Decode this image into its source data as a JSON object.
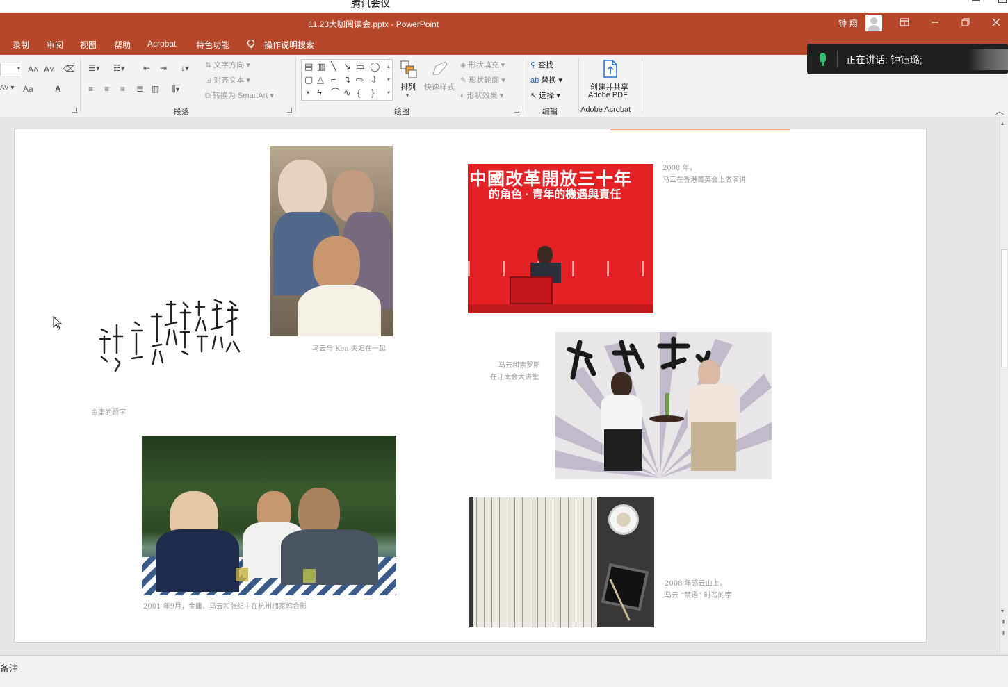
{
  "meeting": {
    "app_title": "腾讯会议"
  },
  "window": {
    "title": "11.23大咖阅读会.pptx  -  PowerPoint",
    "user": "钟 翔"
  },
  "menu": {
    "tabs": [
      "录制",
      "审阅",
      "视图",
      "帮助",
      "Acrobat",
      "特色功能"
    ],
    "search": "操作说明搜索"
  },
  "ribbon": {
    "font_size_up": "A˄",
    "font_size_down": "A˅",
    "change_case": "Aa",
    "font_color": "A",
    "text_direction": "文字方向",
    "align_text": "对齐文本",
    "smartart": "转换为 SmartArt",
    "paragraph_group": "段落",
    "arrange": "排列",
    "quick_styles": "快速样式",
    "shape_fill": "形状填充",
    "shape_outline": "形状轮廓",
    "shape_effects": "形状效果",
    "drawing_group": "绘图",
    "find": "查找",
    "replace": "替换",
    "select": "选择",
    "editing_group": "编辑",
    "create_share_1": "创建并共享",
    "create_share_2": "Adobe PDF",
    "acrobat_group": "Adobe Acrobat"
  },
  "speaking": {
    "text": "正在讲话: 钟钰璐;"
  },
  "slide": {
    "photo_left_top_caption": "马云与 Ken 夫妇在一起",
    "calligraphy_caption": "金庸的题字",
    "photo_left_bottom_caption": "2001 年9月，金庸、马云和张纪中在杭州梅家坞合影",
    "red_banner_title": "中國改革開放三十年",
    "red_banner_subtitle": "的角色 · 青年的機遇與責任",
    "red_photo_caption_1": "2008 年，",
    "red_photo_caption_2": "马云在香港菁英会上做演讲",
    "stage_caption_1": "马云和索罗斯",
    "stage_caption_2": "在江南会大讲堂",
    "tea_caption_1": "2008 年感云山上，",
    "tea_caption_2": "马云 “禁语” 时写的字"
  },
  "notes": {
    "label": "备注"
  },
  "colors": {
    "accent": "#b7472a",
    "ribbon": "#f3f3f3",
    "speaking_bg": "#1f1f1f",
    "mic": "#2fbf71"
  }
}
